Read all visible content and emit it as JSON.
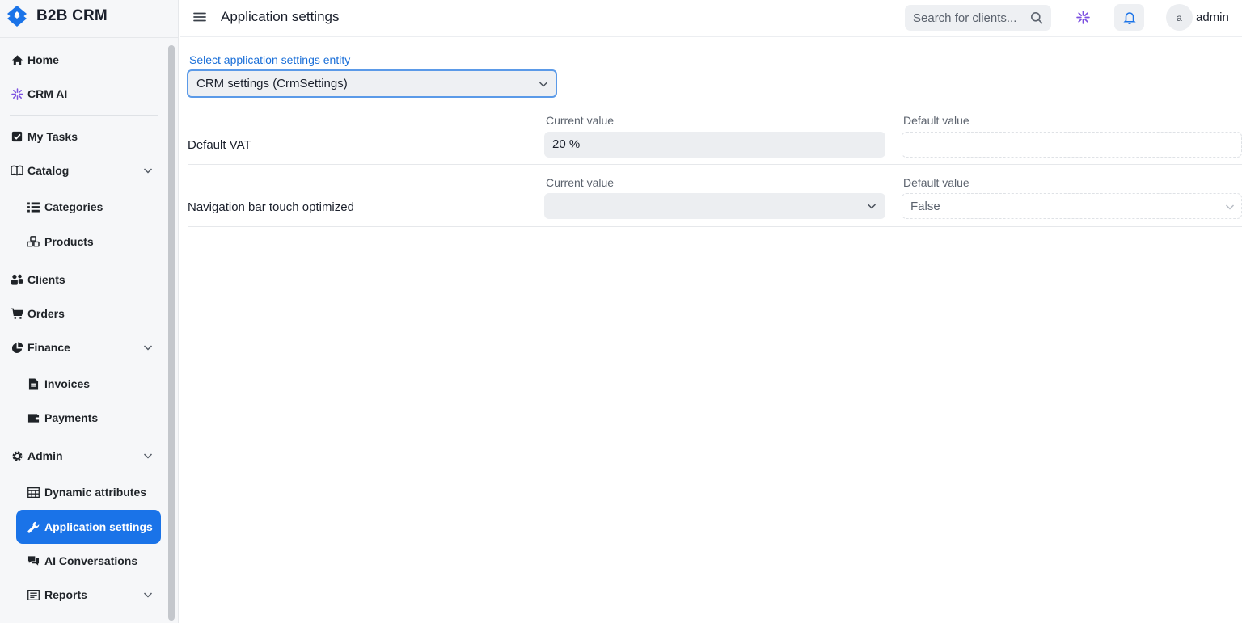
{
  "app": {
    "name": "B2B CRM"
  },
  "header": {
    "title": "Application settings",
    "search_placeholder": "Search for clients...",
    "user_initial": "a",
    "user_name": "admin"
  },
  "sidebar": {
    "items": [
      {
        "label": "Home",
        "icon": "home-icon"
      },
      {
        "label": "CRM AI",
        "icon": "sparkle-icon"
      },
      {
        "label": "My Tasks",
        "icon": "checkbox-icon"
      },
      {
        "label": "Catalog",
        "icon": "book-icon",
        "expandable": true
      },
      {
        "label": "Categories",
        "icon": "list-icon"
      },
      {
        "label": "Products",
        "icon": "cubes-icon"
      },
      {
        "label": "Clients",
        "icon": "users-icon"
      },
      {
        "label": "Orders",
        "icon": "cart-icon"
      },
      {
        "label": "Finance",
        "icon": "pie-chart-icon",
        "expandable": true
      },
      {
        "label": "Invoices",
        "icon": "file-icon"
      },
      {
        "label": "Payments",
        "icon": "wallet-icon"
      },
      {
        "label": "Admin",
        "icon": "gear-icon",
        "expandable": true
      },
      {
        "label": "Dynamic attributes",
        "icon": "table-icon"
      },
      {
        "label": "Application settings",
        "icon": "wrench-icon",
        "active": true
      },
      {
        "label": "AI Conversations",
        "icon": "chat-icon"
      },
      {
        "label": "Reports",
        "icon": "report-icon",
        "expandable": true
      }
    ]
  },
  "main": {
    "entity_label": "Select application settings entity",
    "entity_value": "CRM settings (CrmSettings)",
    "settings": [
      {
        "name": "Default VAT",
        "current_label": "Current value",
        "current_value": "20 %",
        "default_label": "Default value",
        "default_value": ""
      },
      {
        "name": "Navigation bar touch optimized",
        "current_label": "Current value",
        "current_value": "",
        "default_label": "Default value",
        "default_value": "False"
      }
    ]
  },
  "colors": {
    "accent": "#1a73e8",
    "ai_accent": "#7b4fe0"
  }
}
